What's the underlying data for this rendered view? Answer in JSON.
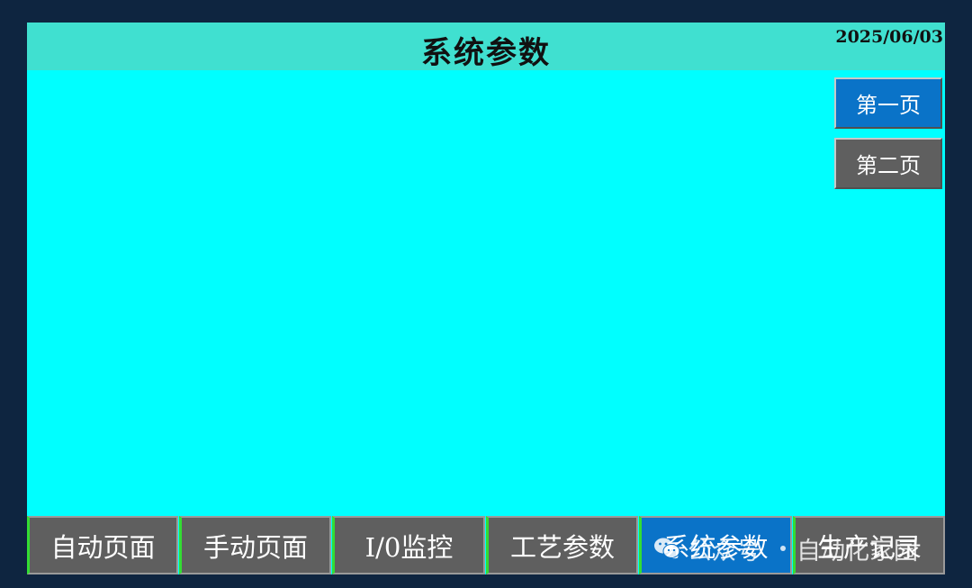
{
  "header": {
    "title": "系统参数",
    "date": "2025/06/03"
  },
  "pages": {
    "page1_label": "第一页",
    "page2_label": "第二页"
  },
  "nav": {
    "items": [
      {
        "label": "自动页面",
        "active": false
      },
      {
        "label": "手动页面",
        "active": false
      },
      {
        "label": "I/0监控",
        "active": false
      },
      {
        "label": "工艺参数",
        "active": false
      },
      {
        "label": "系统参数",
        "active": true
      },
      {
        "label": "生产记录",
        "active": false
      }
    ]
  },
  "watermark": {
    "part1": "公众号",
    "part2": "自动化家园",
    "icon": "wechat-icon"
  },
  "colors": {
    "background": "#0e2540",
    "screen": "#00ffff",
    "titlebar": "#40e0d0",
    "active_button": "#0a73c8",
    "inactive_button": "#5f5f5f",
    "nav_accent": "#33dd33"
  }
}
